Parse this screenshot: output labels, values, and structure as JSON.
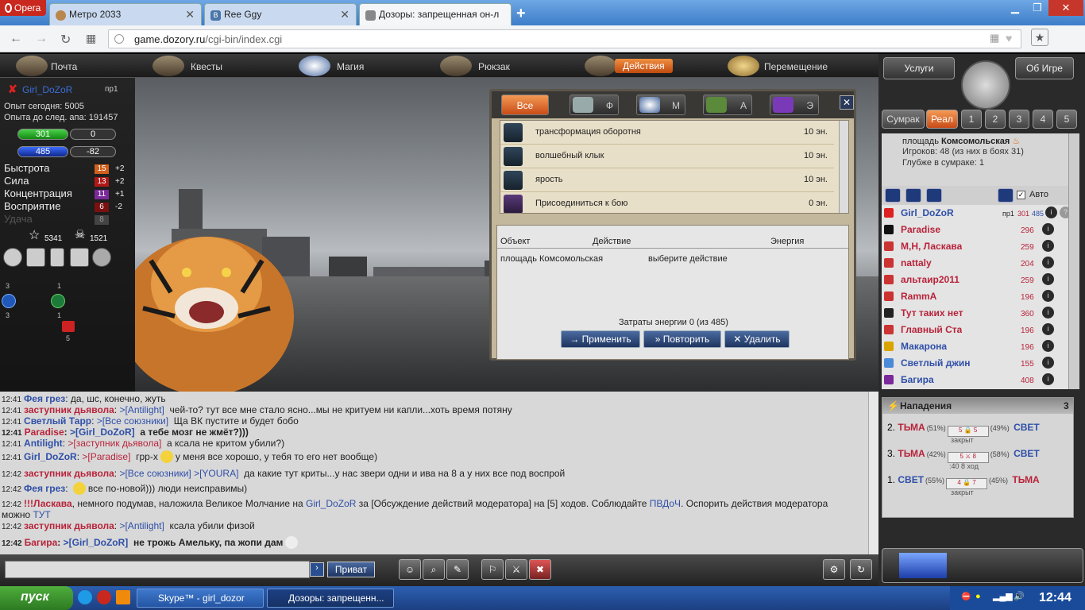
{
  "browser": {
    "opera_label": "Opera",
    "tabs": [
      {
        "title": "Метро 2033",
        "icon_color": "#b9874b"
      },
      {
        "title": "Ree Ggy",
        "icon_color": "#4a76a8"
      },
      {
        "title": "Дозоры: запрещенная он-л",
        "icon_color": "#888888"
      }
    ],
    "url_domain": "game.dozory.ru",
    "url_path": "/cgi-bin/index.cgi"
  },
  "menu": [
    {
      "label": "Почта",
      "icon": "mail-icon"
    },
    {
      "label": "Квесты",
      "icon": "quill-icon"
    },
    {
      "label": "Магия",
      "icon": "magic-icon"
    },
    {
      "label": "Рюкзак",
      "icon": "backpack-icon"
    },
    {
      "label": "Действия",
      "icon": "fist-icon",
      "active": true
    },
    {
      "label": "Перемещение",
      "icon": "compass-icon"
    }
  ],
  "character": {
    "name": "Girl_DoZoR",
    "rank": "пр1",
    "exp_today": "Опыт сегодня: 5005",
    "exp_next": "Опыта до след. апа: 191457",
    "hp": "301",
    "hp_right": "0",
    "energy": "485",
    "energy_right": "-82",
    "stats": [
      {
        "label": "Быстрота",
        "value": "15",
        "delta": "+2",
        "color": "#d0601c"
      },
      {
        "label": "Сила",
        "value": "13",
        "delta": "+2",
        "color": "#b01818"
      },
      {
        "label": "Концентрация",
        "value": "11",
        "delta": "+1",
        "color": "#7a2a9a"
      },
      {
        "label": "Восприятие",
        "value": "6",
        "delta": "-2",
        "color": "#7a1010"
      },
      {
        "label": "Удача",
        "value": "8",
        "delta": "",
        "color": "#444444"
      }
    ],
    "stars": "5341",
    "skulls": "1521",
    "side_a": "3",
    "side_b": "3",
    "side_c": "1",
    "side_d": "1",
    "side_e": "5"
  },
  "dialog": {
    "tabs": [
      {
        "label": "Все",
        "active": true
      },
      {
        "label": "Ф"
      },
      {
        "label": "М"
      },
      {
        "label": "А"
      },
      {
        "label": "Э"
      }
    ],
    "close": "✕",
    "actions": [
      {
        "name": "трансформация оборотня",
        "energy": "10 эн."
      },
      {
        "name": "волшебный клык",
        "energy": "10 эн."
      },
      {
        "name": "ярость",
        "energy": "10 эн."
      },
      {
        "name": "Присоединиться к бою",
        "energy": "0 эн."
      }
    ],
    "table": {
      "col_object": "Объект",
      "col_action": "Действие",
      "col_energy": "Энергия",
      "object": "площадь Комсомольская",
      "action": "выберите действие"
    },
    "energy_cost": "Затраты энергии 0 (из 485)",
    "btn_apply": "Применить",
    "btn_repeat": "Повторить",
    "btn_delete": "Удалить"
  },
  "chat": [
    {
      "t": "12:41",
      "n": "Фея грез",
      "nc": "b",
      "to": "",
      "msg": "да, шс, конечно, жуть"
    },
    {
      "t": "12:41",
      "n": "заступник дьявола",
      "nc": "r",
      "to": ">[Antilight]",
      "msg": "чей-то? тут все мне стало ясно...мы не критуем ни капли...хоть время потяну"
    },
    {
      "t": "12:41",
      "n": "Светлый Тарр",
      "nc": "b",
      "to": ">[Все союзники]",
      "msg": "Ща ВК пустите и будет бобо"
    },
    {
      "t": "12:41",
      "n": "Paradise",
      "nc": "r",
      "to": ">[Girl_DoZoR]",
      "msg": "а тебе мозг не жмёт?)))"
    },
    {
      "t": "12:41",
      "n": "Antilight",
      "nc": "b",
      "to": ">[заступник дьявола]",
      "msg": "а ксала не критом убили?)"
    },
    {
      "t": "12:41",
      "n": "Girl_DoZoR",
      "nc": "b",
      "to": ">[Paradise]",
      "msg": "грр-х",
      "msg2": "у меня все хорошо, у тебя то его нет вообще)"
    },
    {
      "t": "12:42",
      "n": "заступник дьявола",
      "nc": "r",
      "to": ">[Все союзники] >[YOURA]",
      "msg": "да какие тут криты...у нас звери одни и ива на 8 а у них все под воспрой"
    },
    {
      "t": "12:42",
      "n": "Фея грез",
      "nc": "b",
      "to": "",
      "msg": "все по-новой))) люди неисправимы)"
    }
  ],
  "moderation": {
    "t": "12:42",
    "prefix": "!!!Ласкава",
    "text1": ", немного подумав, наложила Великое Молчание на",
    "target": "Girl_DoZoR",
    "text2": "за [Обсуждение действий модератора] на [5] ходов. Соблюдайте",
    "link1": "ПВДоЧ",
    "text3": ". Оспорить действия модератора",
    "text4": "можно",
    "link2": "ТУТ"
  },
  "chat_tail": [
    {
      "t": "12:42",
      "n": "заступник дьявола",
      "to": ">[Antilight]",
      "msg": "ксала убили физой"
    },
    {
      "t": "12:42",
      "n": "Багира",
      "to": ">[Girl_DoZoR]",
      "msg": "не трожь Амельку, па жопи дам"
    }
  ],
  "input": {
    "send": "›",
    "private": "Приват"
  },
  "right": {
    "services": "Услуги",
    "about": "Об Игре",
    "modes": [
      {
        "label": "Сумрак"
      },
      {
        "label": "Реал",
        "active": true
      },
      {
        "label": "1"
      },
      {
        "label": "2"
      },
      {
        "label": "3"
      },
      {
        "label": "4"
      },
      {
        "label": "5"
      }
    ],
    "location_prefix": "площадь",
    "location_name": "Комсомольская",
    "players": "Игроков: 48 (из них в боях 31)",
    "depth": "Глубже в сумраке: 1",
    "auto": "Авто",
    "player_list": [
      {
        "name": "Girl_DoZoR",
        "blue": true,
        "rank": "пр1",
        "level": "301",
        "level2": "485",
        "icon": "#d22"
      },
      {
        "name": "Paradise",
        "level": "296",
        "icon": "#111"
      },
      {
        "name": "М,Н, Ласкава",
        "level": "259",
        "icon": "#c33"
      },
      {
        "name": "nattaly",
        "level": "204",
        "icon": "#c33"
      },
      {
        "name": "альтаир2011",
        "level": "259",
        "icon": "#c33"
      },
      {
        "name": "RammA",
        "level": "196",
        "icon": "#c33"
      },
      {
        "name": "Тут таких нет",
        "level": "360",
        "icon": "#222"
      },
      {
        "name": "Главный Ста",
        "level": "196",
        "icon": "#c33"
      },
      {
        "name": "Макарона",
        "blue": true,
        "level": "196",
        "icon": "#d9a400"
      },
      {
        "name": "Светлый джин",
        "blue": true,
        "level": "155",
        "icon": "#4b8ad8"
      },
      {
        "name": "Багира",
        "blue": true,
        "level": "408",
        "icon": "#7a2a9a"
      }
    ],
    "attacks_title": "Нападения",
    "attacks_count": "3",
    "attacks": [
      {
        "idx": "2.",
        "left": "ТЬМА",
        "lp": "(51%)",
        "a": "5",
        "b": "5",
        "rp": "(49%)",
        "right": "СВЕТ",
        "sub": "закрыт"
      },
      {
        "idx": "3.",
        "left": "ТЬМА",
        "lp": "(42%)",
        "a": "5",
        "b": "8",
        "rp": "(58%)",
        "right": "СВЕТ",
        "sub": ":40  8 ход"
      },
      {
        "idx": "1.",
        "left": "СВЕТ",
        "lp": "(55%)",
        "a": "4",
        "b": "7",
        "rp": "(45%)",
        "right": "ТЬМА",
        "sub": "закрыт"
      }
    ]
  },
  "taskbar": {
    "start": "пуск",
    "windows": [
      {
        "label": "Skype™ - girl_dozor"
      },
      {
        "label": "Дозоры: запрещенн...",
        "active": true
      }
    ],
    "clock": "12:44"
  }
}
